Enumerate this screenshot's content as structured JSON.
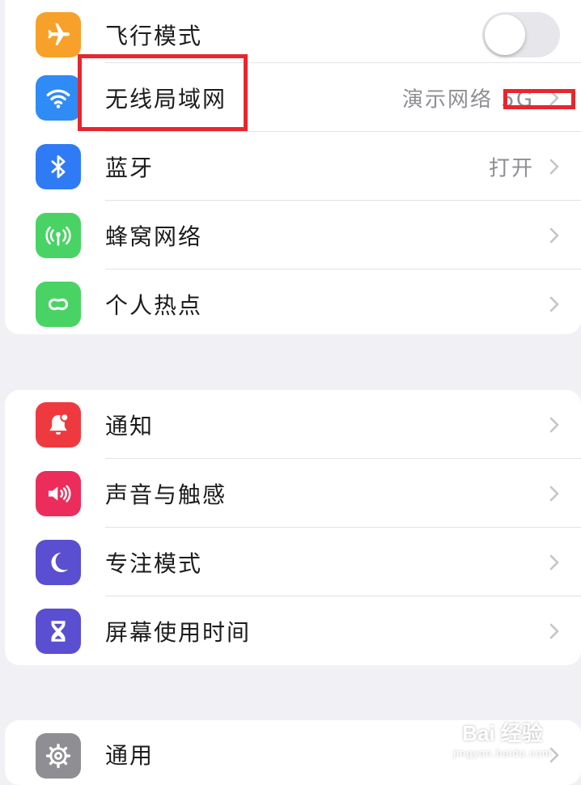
{
  "groups": {
    "connectivity": [
      {
        "label": "飞行模式",
        "icon": "airplane-icon",
        "color": "#f7a12a",
        "control": "toggle",
        "toggle_on": false
      },
      {
        "label": "无线局域网",
        "icon": "wifi-icon",
        "color": "#2f8bf5",
        "value": "演示网络 5G"
      },
      {
        "label": "蓝牙",
        "icon": "bluetooth-icon",
        "color": "#2f7bf5",
        "value": "打开"
      },
      {
        "label": "蜂窝网络",
        "icon": "cellular-icon",
        "color": "#49d364"
      },
      {
        "label": "个人热点",
        "icon": "hotspot-icon",
        "color": "#49d364"
      }
    ],
    "notifications": [
      {
        "label": "通知",
        "icon": "bell-icon",
        "color": "#ee3a3f"
      },
      {
        "label": "声音与触感",
        "icon": "speaker-icon",
        "color": "#ec2d5c"
      },
      {
        "label": "专注模式",
        "icon": "moon-icon",
        "color": "#5a4fd1"
      },
      {
        "label": "屏幕使用时间",
        "icon": "hourglass-icon",
        "color": "#5a4fd1"
      }
    ],
    "general": [
      {
        "label": "通用",
        "icon": "gear-icon",
        "color": "#8e8e93"
      }
    ]
  },
  "watermark": {
    "main": "Bai 经验",
    "sub": "jingyan.baidu.com"
  },
  "highlight_color": "#e7262d"
}
